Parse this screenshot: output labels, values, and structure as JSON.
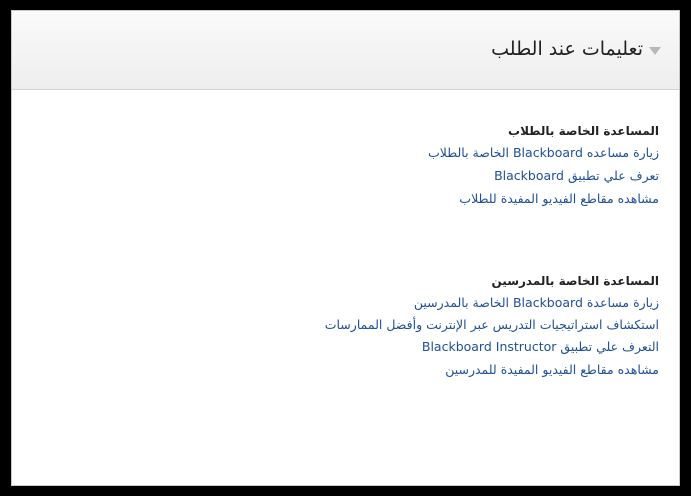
{
  "module": {
    "title": "تعليمات عند الطلب"
  },
  "students_section": {
    "heading": "المساعدة الخاصة بالطلاب",
    "links": [
      "زيارة مساعده Blackboard الخاصة بالطلاب",
      "تعرف علي تطبيق Blackboard",
      "مشاهده مقاطع الفيديو المفيدة للطلاب"
    ]
  },
  "instructors_section": {
    "heading": "المساعدة الخاصة بالمدرسين",
    "links": [
      "زيارة مساعدة Blackboard الخاصة بالمدرسين",
      "استكشاف استراتيجيات التدريس عبر الإنترنت وأفضل الممارسات",
      "التعرف علي تطبيق Blackboard Instructor",
      "مشاهده مقاطع الفيديو المفيدة للمدرسين"
    ]
  },
  "colors": {
    "link": "#1f4f96",
    "heading": "#222222",
    "border": "#c9c9c9",
    "frame": "#000000"
  }
}
